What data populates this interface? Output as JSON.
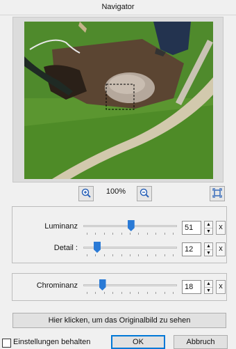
{
  "window": {
    "title": "Navigator"
  },
  "zoom": {
    "value": "100%"
  },
  "sliders": {
    "luminanz": {
      "label": "Luminanz",
      "value": "51",
      "fraction": 0.51
    },
    "detail": {
      "label": "Detail :",
      "value": "12",
      "fraction": 0.12
    },
    "chrominanz": {
      "label": "Chrominanz",
      "value": "18",
      "fraction": 0.18
    }
  },
  "reset_label": "x",
  "original_button": "Hier klicken, um das Originalbild zu sehen",
  "footer": {
    "keep_settings": "Einstellungen behalten",
    "ok": "OK",
    "cancel": "Abbruch"
  },
  "icons": {
    "zoom_in": "zoom-in-icon",
    "zoom_out": "zoom-out-icon",
    "fit": "fit-to-window-icon"
  }
}
